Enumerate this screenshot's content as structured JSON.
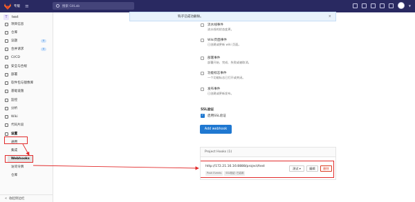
{
  "topbar": {
    "brand": "专版",
    "search_placeholder": "搜索 GitLab"
  },
  "sidebar": {
    "project_initial": "T",
    "project_name": "test",
    "items": [
      {
        "label": "项目信息"
      },
      {
        "label": "仓库"
      },
      {
        "label": "议题",
        "badge": "0"
      },
      {
        "label": "合并请求",
        "badge": "0"
      },
      {
        "label": "CI/CD"
      },
      {
        "label": "安全与合规"
      },
      {
        "label": "部署"
      },
      {
        "label": "软件包与镜像库"
      },
      {
        "label": "基础设施"
      },
      {
        "label": "监控"
      },
      {
        "label": "分析"
      },
      {
        "label": "Wiki"
      },
      {
        "label": "代码片段"
      },
      {
        "label": "设置"
      }
    ],
    "settings_sub": [
      "通用",
      "集成",
      "Webhooks",
      "访问令牌",
      "仓库"
    ],
    "collapse_label": "收起侧边栏"
  },
  "flash": {
    "message": "钩子已成功删除。"
  },
  "events": [
    {
      "title": "流水线事件",
      "desc": "流水线的状态变更。",
      "checked": false
    },
    {
      "title": "Wiki页面事件",
      "desc": "已创建或更新 wiki 页面。",
      "checked": false
    },
    {
      "title": "部署事件",
      "desc": "部署开始、完成、失败或被取消。",
      "checked": false
    },
    {
      "title": "功能标志事件",
      "desc": "一个功能标志已打开或关闭。",
      "checked": false
    },
    {
      "title": "发布事件",
      "desc": "已创建或更新发布。",
      "checked": false
    }
  ],
  "ssl": {
    "title": "SSL验证",
    "checkbox_label": "启用SSL验证",
    "checked": true
  },
  "add_button": "Add webhook",
  "hooks": {
    "header": "Project Hooks (1)",
    "url": "http://172.21.16.16:8888/project/test",
    "tags": [
      "Push Events",
      "SSL验证: 已启用"
    ],
    "test_label": "测试",
    "edit_label": "编辑",
    "delete_label": "删除"
  },
  "colors": {
    "nav": "#292961",
    "primary": "#1f78d1",
    "annotation": "#e22a2a"
  }
}
